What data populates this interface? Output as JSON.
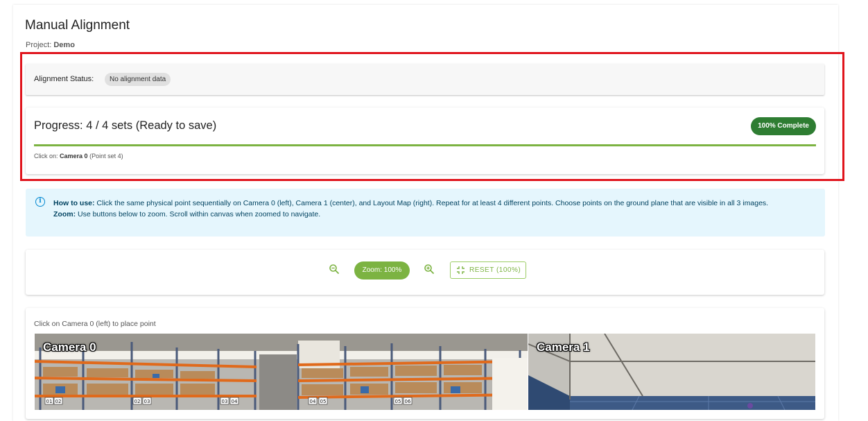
{
  "header": {
    "title": "Manual Alignment",
    "project_label": "Project:",
    "project_name": "Demo"
  },
  "status": {
    "label": "Alignment Status:",
    "chip": "No alignment data"
  },
  "progress": {
    "title": "Progress: 4 / 4 sets (Ready to save)",
    "badge": "100% Complete",
    "percent": 100,
    "click_on_prefix": "Click on:",
    "click_on_target": "Camera 0",
    "click_on_suffix": "(Point set 4)",
    "bar_color": "#7cb342"
  },
  "info": {
    "howto_label": "How to use:",
    "howto_text": "Click the same physical point sequentially on Camera 0 (left), Camera 1 (center), and Layout Map (right). Repeat for at least 4 different points. Choose points on the ground plane that are visible in all 3 images.",
    "zoom_label": "Zoom:",
    "zoom_text": "Use buttons below to zoom. Scroll within canvas when zoomed to navigate."
  },
  "zoom": {
    "level": "Zoom: 100%",
    "reset_label": "RESET (100%)",
    "zoom_out_icon": "zoom-out-icon",
    "zoom_in_icon": "zoom-in-icon",
    "reset_icon": "fullscreen-exit-icon"
  },
  "canvas": {
    "hint": "Click on Camera 0 (left) to place point",
    "cameras": [
      {
        "label": "Camera 0"
      },
      {
        "label": "Camera 1"
      }
    ],
    "rack_tags": [
      "01",
      "02",
      "02",
      "03",
      "03",
      "04",
      "04",
      "05",
      "05",
      "06"
    ]
  },
  "colors": {
    "accent": "#7cb342",
    "complete": "#2e7d32",
    "info_bg": "#e5f6fd",
    "highlight": "#e0141c"
  }
}
